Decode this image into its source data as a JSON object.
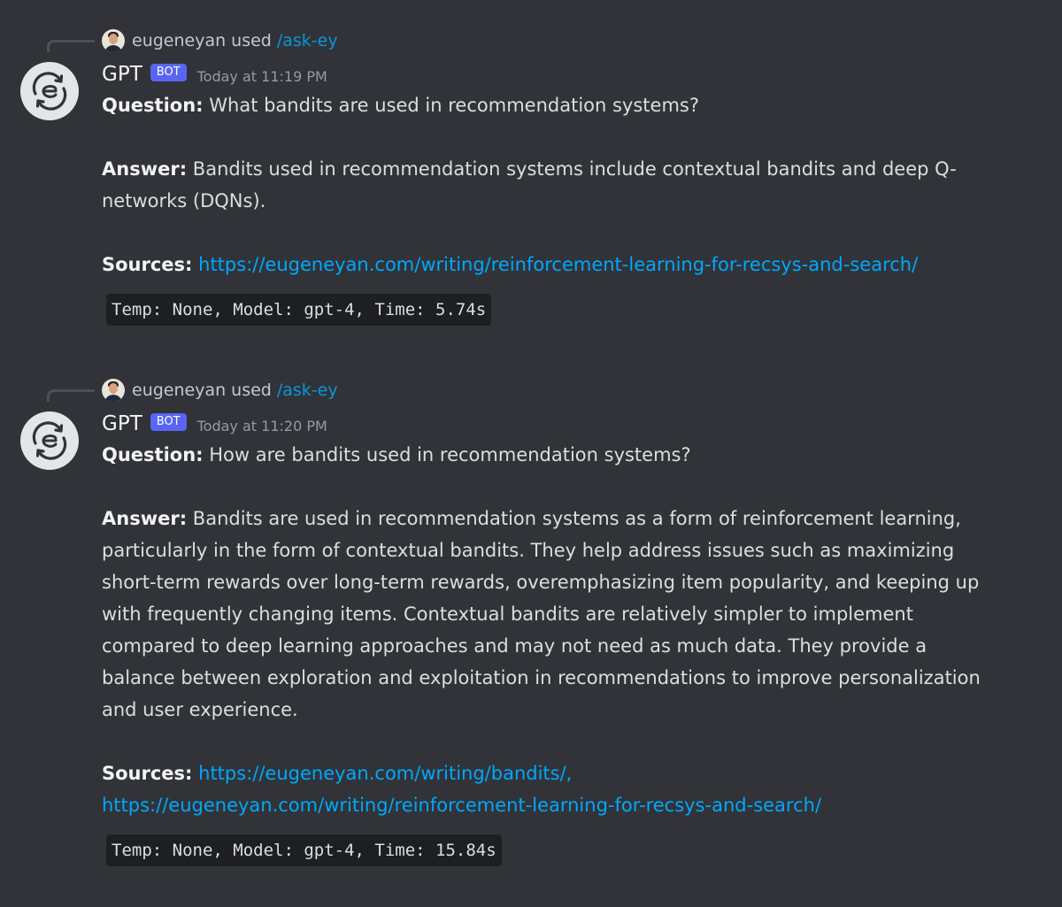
{
  "colors": {
    "background": "#313338",
    "link": "#00a8fc",
    "bot_tag": "#5865f2",
    "text": "#dbdee1"
  },
  "messages": [
    {
      "reply": {
        "user": "eugeneyan",
        "action": "used",
        "command": "/ask-ey",
        "avatar_icon": "user-photo-avatar"
      },
      "author": "GPT",
      "bot_tag": "BOT",
      "avatar_icon": "gpt-circular-arrows-icon",
      "timestamp": "Today at 11:19 PM",
      "question_label": "Question:",
      "question": "What bandits are used in recommendation systems?",
      "answer_label": "Answer:",
      "answer": "Bandits used in recommendation systems include contextual bandits and deep Q-networks (DQNs).",
      "sources_label": "Sources:",
      "sources": [
        "https://eugeneyan.com/writing/reinforcement-learning-for-recsys-and-search/"
      ],
      "meta": "Temp: None, Model: gpt-4, Time: 5.74s"
    },
    {
      "reply": {
        "user": "eugeneyan",
        "action": "used",
        "command": "/ask-ey",
        "avatar_icon": "user-photo-avatar"
      },
      "author": "GPT",
      "bot_tag": "BOT",
      "avatar_icon": "gpt-circular-arrows-icon",
      "timestamp": "Today at 11:20 PM",
      "question_label": "Question:",
      "question": "How are bandits used in recommendation systems?",
      "answer_label": "Answer:",
      "answer": "Bandits are used in recommendation systems as a form of reinforcement learning, particularly in the form of contextual bandits. They help address issues such as maximizing short-term rewards over long-term rewards, overemphasizing item popularity, and keeping up with frequently changing items. Contextual bandits are relatively simpler to implement compared to deep learning approaches and may not need as much data. They provide a balance between exploration and exploitation in recommendations to improve personalization and user experience.",
      "sources_label": "Sources:",
      "sources": [
        "https://eugeneyan.com/writing/bandits/,",
        "https://eugeneyan.com/writing/reinforcement-learning-for-recsys-and-search/"
      ],
      "meta": "Temp: None, Model: gpt-4, Time: 15.84s"
    }
  ]
}
